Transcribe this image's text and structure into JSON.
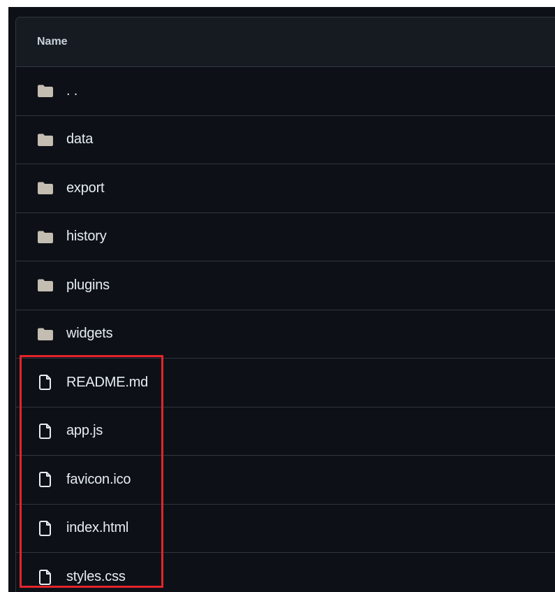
{
  "table": {
    "header": "Name",
    "rows": [
      {
        "type": "folder",
        "icon": "folder-icon",
        "label": ". ."
      },
      {
        "type": "folder",
        "icon": "folder-icon",
        "label": "data"
      },
      {
        "type": "folder",
        "icon": "folder-icon",
        "label": "export"
      },
      {
        "type": "folder",
        "icon": "folder-icon",
        "label": "history"
      },
      {
        "type": "folder",
        "icon": "folder-icon",
        "label": "plugins"
      },
      {
        "type": "folder",
        "icon": "folder-icon",
        "label": "widgets"
      },
      {
        "type": "file",
        "icon": "file-icon",
        "label": "README.md"
      },
      {
        "type": "file",
        "icon": "file-icon",
        "label": "app.js"
      },
      {
        "type": "file",
        "icon": "file-icon",
        "label": "favicon.ico"
      },
      {
        "type": "file",
        "icon": "file-icon",
        "label": "index.html"
      },
      {
        "type": "file",
        "icon": "file-icon",
        "label": "styles.css"
      }
    ]
  },
  "colors": {
    "background": "#0d1117",
    "header_background": "#161b22",
    "border": "#30363d",
    "text": "#e6edf3",
    "folder_icon": "#c4bdb1",
    "file_icon": "#e6edf3",
    "highlight": "#e5232b"
  }
}
